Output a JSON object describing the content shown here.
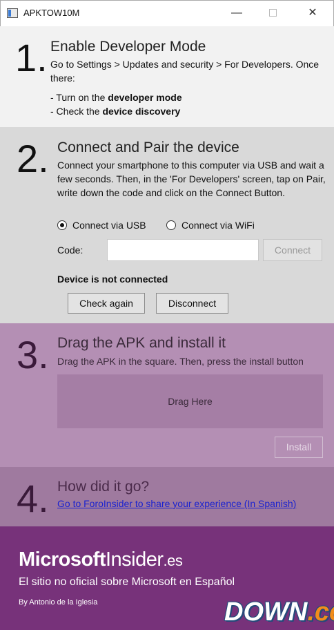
{
  "window": {
    "title": "APKTOW10M",
    "minimize": "—",
    "close": "✕"
  },
  "step1": {
    "number": "1.",
    "title": "Enable Developer Mode",
    "text": "Go to Settings > Updates and security > For Developers. Once there:",
    "item1_prefix": "- Turn on the ",
    "item1_bold": "developer mode",
    "item2_prefix": "- Check the ",
    "item2_bold": "device discovery"
  },
  "step2": {
    "number": "2.",
    "title": "Connect and Pair the device",
    "text": "Connect your smartphone to this computer via USB and wait a few seconds. Then, in the 'For Developers' screen, tap on Pair, write down the code and click on the Connect Button.",
    "radio_usb": "Connect via USB",
    "radio_wifi": "Connect via WiFi",
    "selected": "usb",
    "code_label": "Code:",
    "code_value": "",
    "connect_button": "Connect",
    "status": "Device is not connected",
    "check_again_button": "Check again",
    "disconnect_button": "Disconnect"
  },
  "step3": {
    "number": "3.",
    "title": "Drag the APK and install it",
    "text": "Drag the APK in the square. Then, press the install button",
    "drop_label": "Drag Here",
    "install_button": "Install"
  },
  "step4": {
    "number": "4.",
    "title": "How did it go?",
    "link": "Go to ForoInsider to share your experience (In Spanish)"
  },
  "footer": {
    "brand_part1": "Microsoft",
    "brand_part2": "Insider",
    "brand_part3": ".es",
    "tagline": "El sitio no oficial sobre Microsoft en Español",
    "byline": "By Antonio de la Iglesia",
    "watermark_main": "DOWN",
    "watermark_suffix": ".cc"
  },
  "colors": {
    "step1_bg": "#f2f2f2",
    "step2_bg": "#d9d9d9",
    "step3_bg": "#b48fb4",
    "step4_bg": "#9f7a9f",
    "footer_bg": "#77327a",
    "link": "#1a22d0"
  }
}
